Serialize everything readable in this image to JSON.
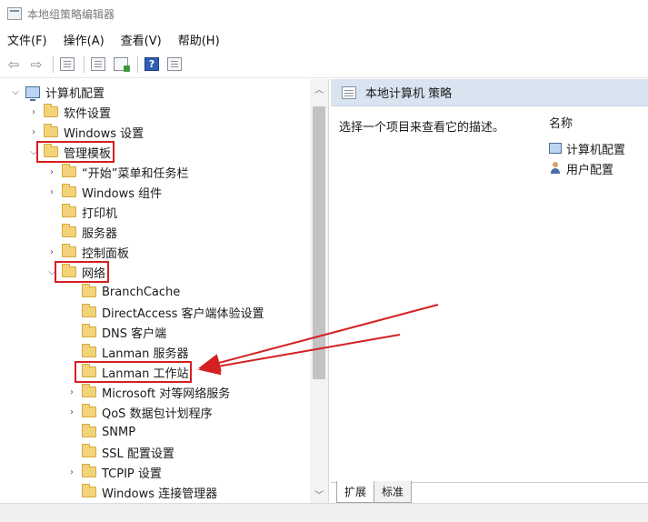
{
  "window": {
    "title": "本地组策略编辑器"
  },
  "menu": [
    "文件(F)",
    "操作(A)",
    "查看(V)",
    "帮助(H)"
  ],
  "toolbar": {
    "icons": [
      "back-arrow-icon",
      "forward-arrow-icon",
      "show-tree-icon",
      "properties-icon",
      "export-list-icon",
      "help-icon",
      "show-hide-icon"
    ],
    "help_glyph": "?"
  },
  "tree": [
    {
      "label": "计算机配置",
      "expand": "open",
      "icon": "computer"
    },
    {
      "label": "软件设置",
      "expand": "closed",
      "icon": "folder"
    },
    {
      "label": "Windows 设置",
      "expand": "closed",
      "icon": "folder"
    },
    {
      "label": "管理模板",
      "expand": "open",
      "icon": "folder",
      "highlighted": true
    },
    {
      "label": "“开始”菜单和任务栏",
      "expand": "closed",
      "icon": "folder"
    },
    {
      "label": "Windows 组件",
      "expand": "closed",
      "icon": "folder"
    },
    {
      "label": "打印机",
      "expand": "none",
      "icon": "folder"
    },
    {
      "label": "服务器",
      "expand": "none",
      "icon": "folder"
    },
    {
      "label": "控制面板",
      "expand": "closed",
      "icon": "folder"
    },
    {
      "label": "网络",
      "expand": "open",
      "icon": "folder",
      "highlighted": true
    },
    {
      "label": "BranchCache",
      "expand": "none",
      "icon": "folder"
    },
    {
      "label": "DirectAccess 客户端体验设置",
      "expand": "none",
      "icon": "folder"
    },
    {
      "label": "DNS 客户端",
      "expand": "none",
      "icon": "folder"
    },
    {
      "label": "Lanman 服务器",
      "expand": "none",
      "icon": "folder"
    },
    {
      "label": "Lanman 工作站",
      "expand": "none",
      "icon": "folder",
      "highlighted": true
    },
    {
      "label": "Microsoft 对等网络服务",
      "expand": "closed",
      "icon": "folder"
    },
    {
      "label": "QoS 数据包计划程序",
      "expand": "closed",
      "icon": "folder"
    },
    {
      "label": "SNMP",
      "expand": "none",
      "icon": "folder"
    },
    {
      "label": "SSL 配置设置",
      "expand": "none",
      "icon": "folder"
    },
    {
      "label": "TCPIP 设置",
      "expand": "closed",
      "icon": "folder"
    },
    {
      "label": "Windows 连接管理器",
      "expand": "none",
      "icon": "folder"
    }
  ],
  "right_pane": {
    "header": "本地计算机 策略",
    "description": "选择一个项目来查看它的描述。",
    "column_header": "名称",
    "items": [
      {
        "label": "计算机配置",
        "icon": "computer-icon"
      },
      {
        "label": "用户配置",
        "icon": "user-icon"
      }
    ]
  },
  "tabs": [
    "扩展",
    "标准"
  ],
  "annotation_color": "#d42020"
}
